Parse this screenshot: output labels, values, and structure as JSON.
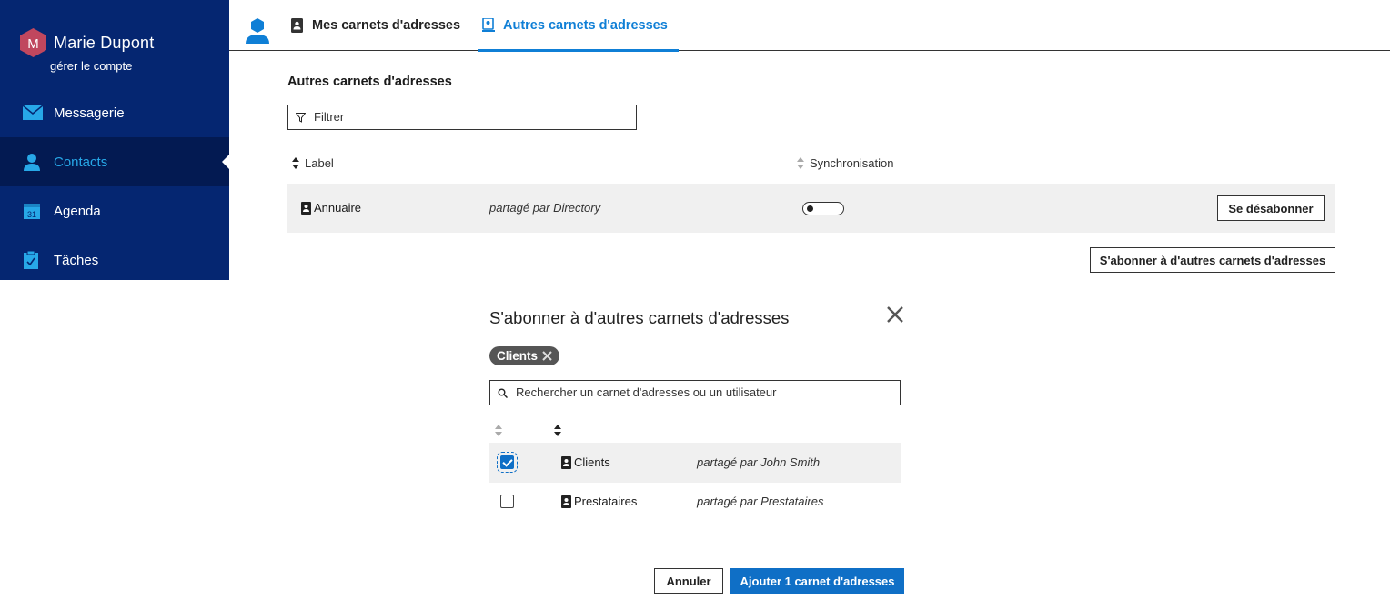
{
  "user": {
    "initial": "M",
    "name": "Marie Dupont",
    "manage_label": "gérer le compte"
  },
  "nav": {
    "items": [
      {
        "label": "Messagerie",
        "icon": "mail-icon"
      },
      {
        "label": "Contacts",
        "icon": "contacts-icon",
        "active": true
      },
      {
        "label": "Agenda",
        "icon": "calendar-icon",
        "day": "31"
      },
      {
        "label": "Tâches",
        "icon": "tasks-icon"
      }
    ]
  },
  "tabs": [
    {
      "label": "Mes carnets d'adresses",
      "icon": "address-book-icon"
    },
    {
      "label": "Autres carnets d'adresses",
      "icon": "shared-address-book-icon",
      "active": true
    }
  ],
  "main": {
    "title": "Autres carnets d'adresses",
    "filter_placeholder": "Filtrer",
    "columns": {
      "label": "Label",
      "sync": "Synchronisation"
    },
    "rows": [
      {
        "name": "Annuaire",
        "shared": "partagé par Directory",
        "sync": false,
        "action": "Se désabonner"
      }
    ],
    "subscribe_button": "S'abonner à d'autres carnets d'adresses"
  },
  "dialog": {
    "title": "S'abonner à d'autres carnets d'adresses",
    "selected_chip": "Clients",
    "search_placeholder": "Rechercher un carnet d'adresses ou un utilisateur",
    "rows": [
      {
        "name": "Clients",
        "shared": "partagé par John Smith",
        "checked": true
      },
      {
        "name": "Prestataires",
        "shared": "partagé par Prestataires",
        "checked": false
      }
    ],
    "cancel_label": "Annuler",
    "add_label": "Ajouter 1 carnet d'adresses"
  },
  "colors": {
    "sidebar": "#052671",
    "sidebar_active": "#031a52",
    "accent": "#0f7fd6",
    "primary_button": "#0f6fc6",
    "avatar": "#c0475e"
  }
}
